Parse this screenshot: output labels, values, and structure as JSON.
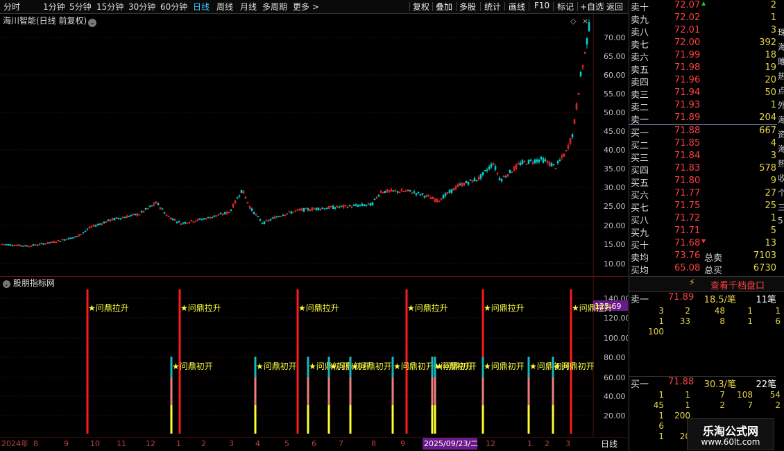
{
  "toolbar": {
    "periods": [
      "分时",
      "1分钟",
      "5分钟",
      "15分钟",
      "30分钟",
      "60分钟",
      "日线",
      "周线",
      "月线",
      "多周期",
      "更多 >"
    ],
    "active_period": "日线",
    "tools": [
      "复权",
      "叠加",
      "多股",
      "统计",
      "画线",
      "F10",
      "标记",
      "+自选",
      "返回"
    ]
  },
  "chart": {
    "title": "海川智能(日线 前复权)",
    "price_axis": [
      "70.00",
      "65.00",
      "60.00",
      "55.00",
      "50.00",
      "45.00",
      "40.00",
      "35.00",
      "30.00",
      "25.00",
      "20.00",
      "15.00",
      "10.00"
    ]
  },
  "indicator": {
    "title": "股朋指标网",
    "axis": [
      "140.00",
      "120.00",
      "100.00",
      "80.00",
      "60.00",
      "40.00",
      "20.00"
    ],
    "current_value": "125.69",
    "signal_high": "★问鼎拉升",
    "signal_mid": "★问鼎初开"
  },
  "date_axis": {
    "labels": [
      "2024年",
      "8",
      "9",
      "10",
      "11",
      "12",
      "1",
      "2",
      "3",
      "4",
      "5",
      "6",
      "7",
      "8",
      "9",
      "2025/09/23/二",
      "12",
      "1",
      "2",
      "3"
    ],
    "period_label": "日线"
  },
  "orderbook": {
    "asks": [
      {
        "label": "卖十",
        "price": "72.07",
        "vol": "2",
        "mark": "up"
      },
      {
        "label": "卖九",
        "price": "72.02",
        "vol": "1"
      },
      {
        "label": "卖八",
        "price": "72.01",
        "vol": "3"
      },
      {
        "label": "卖七",
        "price": "72.00",
        "vol": "392"
      },
      {
        "label": "卖六",
        "price": "71.99",
        "vol": "18"
      },
      {
        "label": "卖五",
        "price": "71.98",
        "vol": "19"
      },
      {
        "label": "卖四",
        "price": "71.96",
        "vol": "20"
      },
      {
        "label": "卖三",
        "price": "71.94",
        "vol": "50"
      },
      {
        "label": "卖二",
        "price": "71.93",
        "vol": "1"
      },
      {
        "label": "卖一",
        "price": "71.89",
        "vol": "204"
      }
    ],
    "bids": [
      {
        "label": "买一",
        "price": "71.88",
        "vol": "667"
      },
      {
        "label": "买二",
        "price": "71.85",
        "vol": "4"
      },
      {
        "label": "买三",
        "price": "71.84",
        "vol": "3"
      },
      {
        "label": "买四",
        "price": "71.83",
        "vol": "578"
      },
      {
        "label": "买五",
        "price": "71.80",
        "vol": "9"
      },
      {
        "label": "买六",
        "price": "71.77",
        "vol": "27"
      },
      {
        "label": "买七",
        "price": "71.75",
        "vol": "25"
      },
      {
        "label": "买八",
        "price": "71.72",
        "vol": "1"
      },
      {
        "label": "买九",
        "price": "71.71",
        "vol": "5"
      },
      {
        "label": "买十",
        "price": "71.68",
        "vol": "13",
        "mark": "down"
      }
    ],
    "ask_avg_label": "卖均",
    "ask_avg": "73.76",
    "total_sell_label": "总卖",
    "total_sell": "7103",
    "bid_avg_label": "买均",
    "bid_avg": "65.08",
    "total_buy_label": "总买",
    "total_buy": "6730",
    "level_button": "查看千档盘口",
    "sell1": {
      "label": "卖一",
      "price": "71.89",
      "avg": "18.5/笔",
      "count": "11笔"
    },
    "sell1_ticks": [
      [
        "3",
        "2",
        "48",
        "1",
        "1"
      ],
      [
        "1",
        "33",
        "8",
        "1",
        "6"
      ],
      [
        "100",
        "",
        "",
        "",
        ""
      ]
    ],
    "buy1": {
      "label": "买一",
      "price": "71.88",
      "avg": "30.3/笔",
      "count": "22笔"
    },
    "buy1_ticks": [
      [
        "1",
        "1",
        "7",
        "108",
        "54"
      ],
      [
        "45",
        "1",
        "2",
        "7",
        "2"
      ],
      [
        "1",
        "200",
        "",
        "",
        ""
      ],
      [
        "6",
        "",
        "",
        "",
        ""
      ],
      [
        "1",
        "20",
        "",
        "",
        ""
      ]
    ]
  },
  "side_strip": [
    "珠",
    "海",
    "睢",
    "热",
    "点",
    "外",
    "海",
    "资",
    "海",
    "热",
    "收",
    "个",
    "三",
    "5"
  ],
  "watermark": {
    "top": "乐淘公式网",
    "bottom": "www.60lt.com"
  },
  "colors": {
    "up": "#ff3030",
    "down": "#00d0d0",
    "signal_high": "#ff1a1a",
    "signal_yellow": "#ffff30",
    "signal_cyan": "#17b8c0",
    "signal_pink": "#f08080",
    "text_yellow": "#ffff40"
  }
}
